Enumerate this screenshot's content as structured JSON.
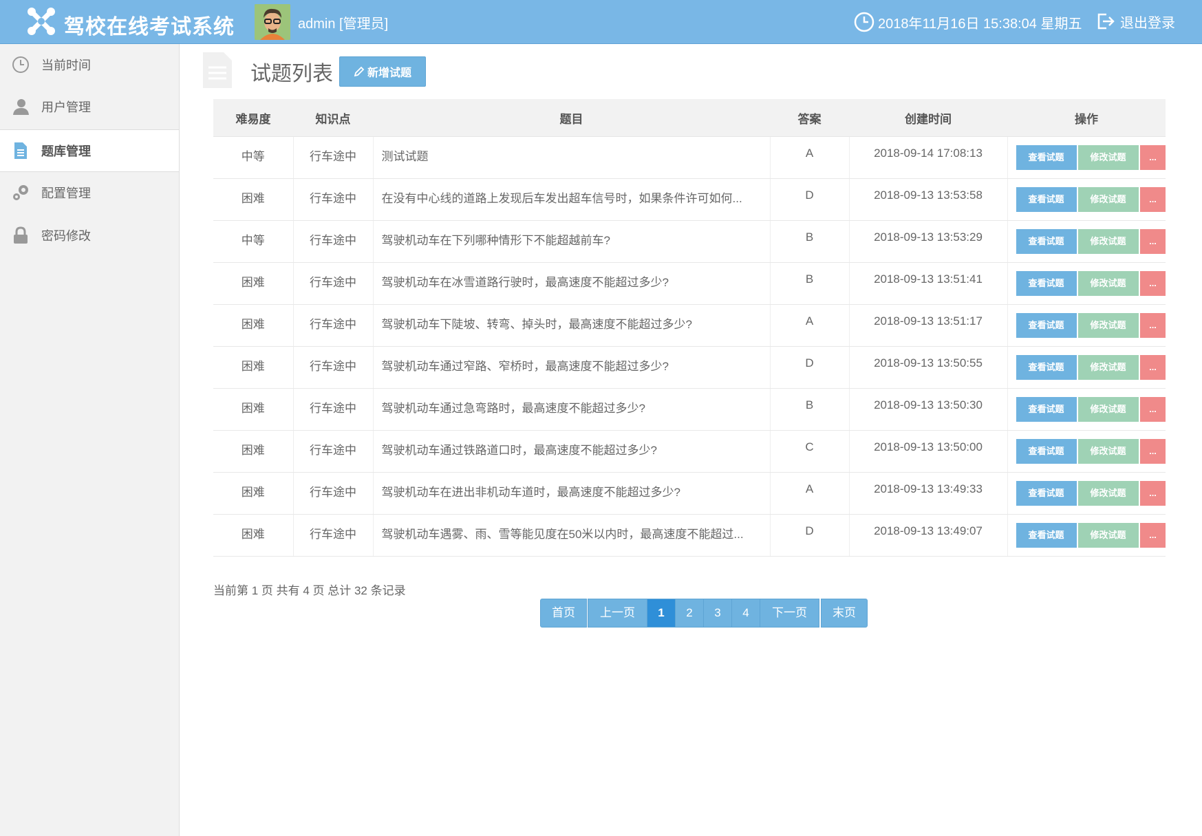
{
  "header": {
    "app_title": "驾校在线考试系统",
    "user": "admin [管理员]",
    "datetime": "2018年11月16日 15:38:04 星期五",
    "logout": "退出登录"
  },
  "sidebar": {
    "items": [
      {
        "label": "当前时间",
        "icon": "clock-icon"
      },
      {
        "label": "用户管理",
        "icon": "user-icon"
      },
      {
        "label": "题库管理",
        "icon": "document-icon",
        "active": true
      },
      {
        "label": "配置管理",
        "icon": "gears-icon"
      },
      {
        "label": "密码修改",
        "icon": "lock-icon"
      }
    ]
  },
  "main": {
    "title": "试题列表",
    "add_button": "新增试题",
    "columns": [
      "难易度",
      "知识点",
      "题目",
      "答案",
      "创建时间",
      "操作"
    ],
    "rows": [
      {
        "difficulty": "中等",
        "topic": "行车途中",
        "question": "测试试题",
        "answer": "A",
        "created": "2018-09-14 17:08:13"
      },
      {
        "difficulty": "困难",
        "topic": "行车途中",
        "question": "在没有中心线的道路上发现后车发出超车信号时，如果条件许可如何...",
        "answer": "D",
        "created": "2018-09-13 13:53:58"
      },
      {
        "difficulty": "中等",
        "topic": "行车途中",
        "question": "驾驶机动车在下列哪种情形下不能超越前车?",
        "answer": "B",
        "created": "2018-09-13 13:53:29"
      },
      {
        "difficulty": "困难",
        "topic": "行车途中",
        "question": "驾驶机动车在冰雪道路行驶时，最高速度不能超过多少?",
        "answer": "B",
        "created": "2018-09-13 13:51:41"
      },
      {
        "difficulty": "困难",
        "topic": "行车途中",
        "question": "驾驶机动车下陡坡、转弯、掉头时，最高速度不能超过多少?",
        "answer": "A",
        "created": "2018-09-13 13:51:17"
      },
      {
        "difficulty": "困难",
        "topic": "行车途中",
        "question": "驾驶机动车通过窄路、窄桥时，最高速度不能超过多少?",
        "answer": "D",
        "created": "2018-09-13 13:50:55"
      },
      {
        "difficulty": "困难",
        "topic": "行车途中",
        "question": "驾驶机动车通过急弯路时，最高速度不能超过多少?",
        "answer": "B",
        "created": "2018-09-13 13:50:30"
      },
      {
        "difficulty": "困难",
        "topic": "行车途中",
        "question": "驾驶机动车通过铁路道口时，最高速度不能超过多少?",
        "answer": "C",
        "created": "2018-09-13 13:50:00"
      },
      {
        "difficulty": "困难",
        "topic": "行车途中",
        "question": "驾驶机动车在进出非机动车道时，最高速度不能超过多少?",
        "answer": "A",
        "created": "2018-09-13 13:49:33"
      },
      {
        "difficulty": "困难",
        "topic": "行车途中",
        "question": "驾驶机动车遇雾、雨、雪等能见度在50米以内时，最高速度不能超过...",
        "answer": "D",
        "created": "2018-09-13 13:49:07"
      }
    ],
    "row_actions": {
      "view": "查看试题",
      "edit": "修改试题",
      "more": "..."
    }
  },
  "pagination": {
    "info": "当前第 1 页 共有 4 页 总计 32 条记录",
    "first": "首页",
    "prev": "上一页",
    "pages": [
      "1",
      "2",
      "3",
      "4"
    ],
    "current": "1",
    "next": "下一页",
    "last": "末页"
  },
  "colors": {
    "header": "#79b7e6",
    "view": "#6fb3e0",
    "edit": "#9fd2b5",
    "delete": "#f08a8a",
    "active_page": "#2f8fd8"
  }
}
